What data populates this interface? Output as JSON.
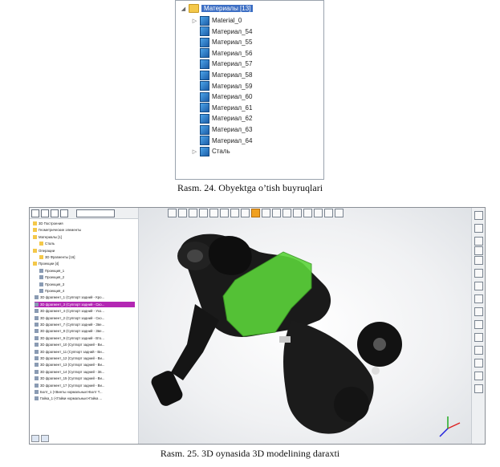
{
  "tree_panel": {
    "root_label": "Материалы [13]",
    "items": [
      {
        "label": "Material_0",
        "expander": "▷"
      },
      {
        "label": "Материал_54",
        "expander": ""
      },
      {
        "label": "Материал_55",
        "expander": ""
      },
      {
        "label": "Материал_56",
        "expander": ""
      },
      {
        "label": "Материал_57",
        "expander": ""
      },
      {
        "label": "Материал_58",
        "expander": ""
      },
      {
        "label": "Материал_59",
        "expander": ""
      },
      {
        "label": "Материал_60",
        "expander": ""
      },
      {
        "label": "Материал_61",
        "expander": ""
      },
      {
        "label": "Материал_62",
        "expander": ""
      },
      {
        "label": "Материал_63",
        "expander": ""
      },
      {
        "label": "Материал_64",
        "expander": ""
      },
      {
        "label": "Сталь",
        "expander": "▷"
      }
    ]
  },
  "caption_1": "Rasm. 24. Obyektga o’tish buyruqlari",
  "cad": {
    "tree": [
      "3D Построения",
      "Геометрические элементы",
      "Материалы [1]",
      "Сталь",
      "Операции",
      "3D Фрагменты [16]",
      "Проекции [4]",
      "Проекция_1",
      "Проекция_2",
      "Проекция_3",
      "Проекция_4",
      "3D фрагмент_1 (Суппорт задний - Кро...",
      "3D фрагмент_3 (Суппорт задний - Ско...",
      "3D фрагмент_4 (Суппорт задний - Ухо...",
      "3D фрагмент_2 (Суппорт задний - Ско...",
      "3D фрагмент_7 (Суппорт задний - Зве...",
      "3D фрагмент_8 (Суппорт задний - Зве...",
      "3D фрагмент_9 (Суппорт задний - Вто...",
      "3D фрагмент_10 (Суппорт задний - Ви...",
      "3D фрагмент_11 (Суппорт задний - Ви...",
      "3D фрагмент_12 (Суппорт задний - Ви...",
      "3D фрагмент_13 (Суппорт задний - Ви...",
      "3D фрагмент_14 (Суппорт задний - Зв...",
      "3D фрагмент_15 (Суппорт задний - Ви...",
      "3D фрагмент_17 (Суппорт задний - Ви...",
      "Болт_1 (<Винты нормальные>Болт T...",
      "Гайка_1 (<Гайки нормальные>Гайка ..."
    ],
    "highlight_color": "#b327b3",
    "model_color": "#1a1a1a",
    "selected_color": "#5bd43a"
  },
  "caption_2": "Rasm. 25. 3D oynasida 3D modelining daraxti"
}
